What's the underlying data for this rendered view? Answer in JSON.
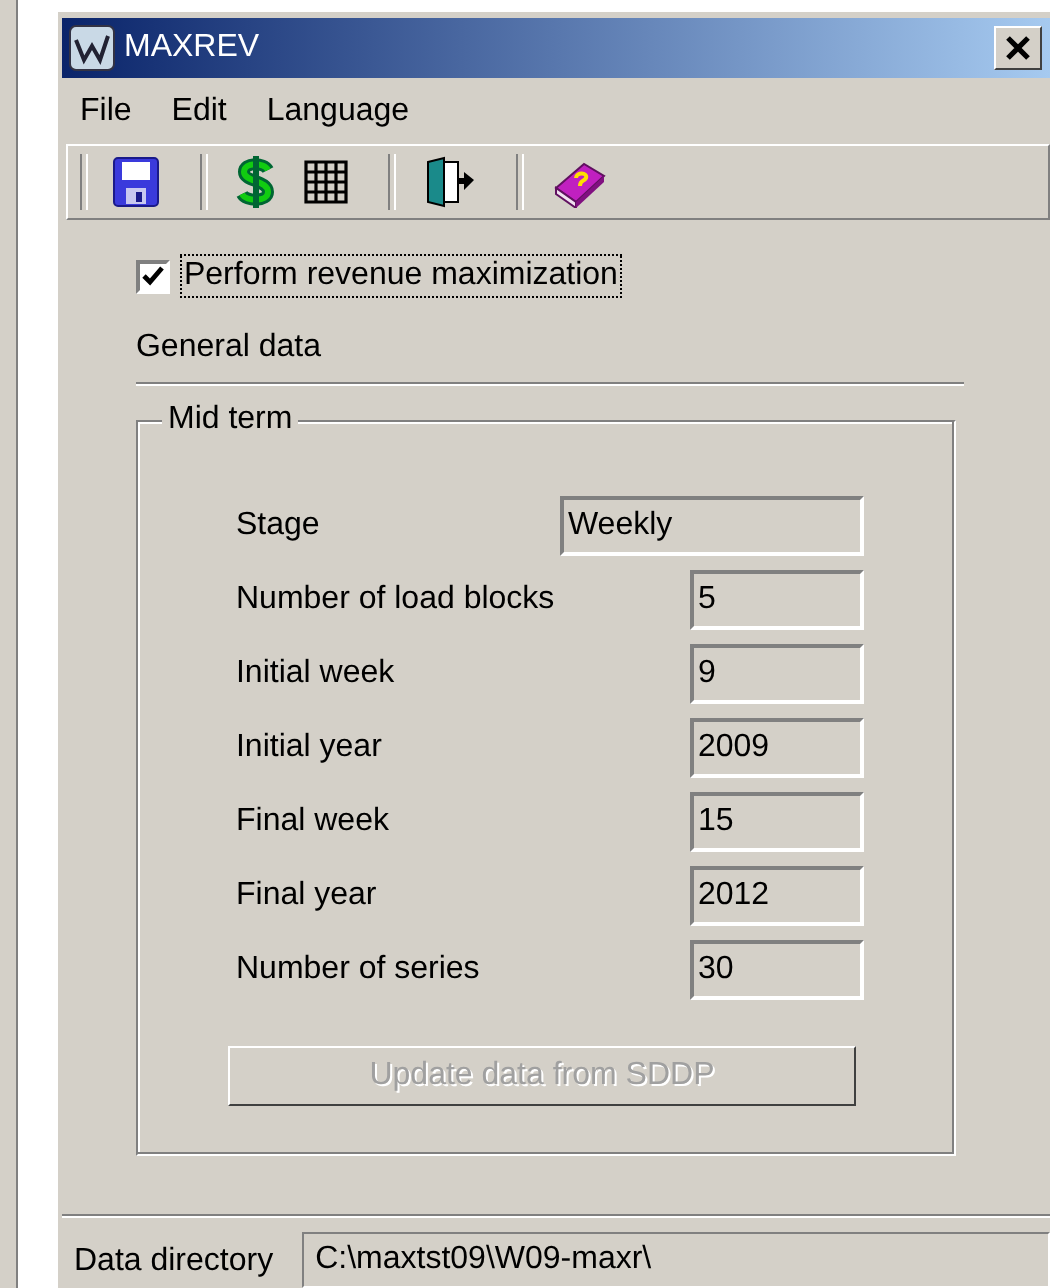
{
  "window": {
    "title": "MAXREV"
  },
  "menu": [
    "File",
    "Edit",
    "Language"
  ],
  "revenue_maximization": {
    "label": "Perform revenue maximization",
    "checked": true
  },
  "section_title": "General data",
  "group": {
    "title": "Mid term",
    "fields": [
      {
        "label": "Stage",
        "value": "Weekly",
        "kind": "wide"
      },
      {
        "label": "Number of load blocks",
        "value": "5",
        "kind": "narrow"
      },
      {
        "label": "Initial week",
        "value": "9",
        "kind": "narrow"
      },
      {
        "label": "Initial year",
        "value": "2009",
        "kind": "narrow"
      },
      {
        "label": "Final week",
        "value": "15",
        "kind": "narrow"
      },
      {
        "label": "Final year",
        "value": "2012",
        "kind": "narrow"
      },
      {
        "label": "Number of series",
        "value": "30",
        "kind": "narrow"
      }
    ]
  },
  "update_button": {
    "label": "Update data from SDDP",
    "disabled": true
  },
  "status_bar": {
    "label": "Data directory",
    "value": "C:\\maxtst09\\W09-maxr\\"
  }
}
